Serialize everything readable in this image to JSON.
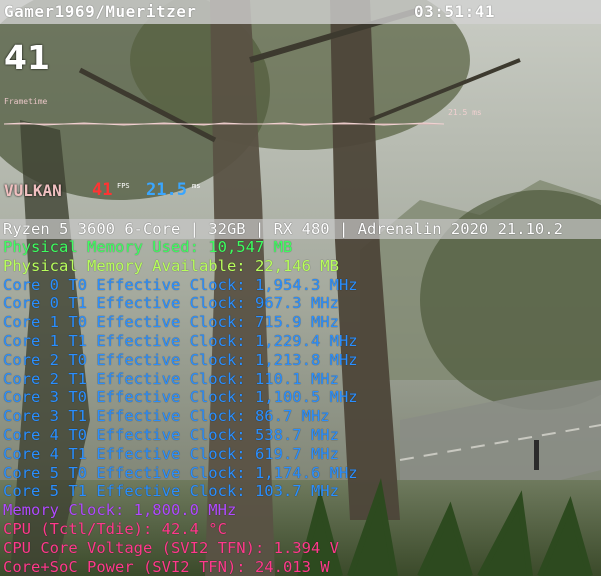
{
  "header": {
    "user": "Gamer1969/Mueritzer",
    "clock": "03:51:41"
  },
  "fps_big": "41",
  "frametime": {
    "label": "Frametime",
    "value": "21.5 ms"
  },
  "api": {
    "name": "VULKAN",
    "fps": "41",
    "fps_unit": "FPS",
    "ms": "21.5",
    "ms_unit": "ms"
  },
  "system": "Ryzen 5 3600 6-Core | 32GB | RX 480 | Adrenalin 2020 21.10.2",
  "stats": [
    {
      "text": "Physical Memory Used: 10,547 MB",
      "color": "green"
    },
    {
      "text": "Physical Memory Available: 22,146 MB",
      "color": "lime"
    },
    {
      "text": "Core 0 T0 Effective Clock: 1,954.3 MHz",
      "color": "blue"
    },
    {
      "text": "Core 0 T1 Effective Clock: 967.3 MHz",
      "color": "blue"
    },
    {
      "text": "Core 1 T0 Effective Clock: 715.9 MHz",
      "color": "blue"
    },
    {
      "text": "Core 1 T1 Effective Clock: 1,229.4 MHz",
      "color": "blue"
    },
    {
      "text": "Core 2 T0 Effective Clock: 1,213.8 MHz",
      "color": "blue"
    },
    {
      "text": "Core 2 T1 Effective Clock: 110.1 MHz",
      "color": "blue"
    },
    {
      "text": "Core 3 T0 Effective Clock: 1,100.5 MHz",
      "color": "blue"
    },
    {
      "text": "Core 3 T1 Effective Clock: 86.7 MHz",
      "color": "blue"
    },
    {
      "text": "Core 4 T0 Effective Clock: 538.7 MHz",
      "color": "blue"
    },
    {
      "text": "Core 4 T1 Effective Clock: 619.7 MHz",
      "color": "blue"
    },
    {
      "text": "Core 5 T0 Effective Clock: 1,174.6 MHz",
      "color": "blue"
    },
    {
      "text": "Core 5 T1 Effective Clock: 103.7 MHz",
      "color": "blue"
    },
    {
      "text": "Memory Clock: 1,800.0 MHz",
      "color": "purple"
    },
    {
      "text": "CPU (Tctl/Tdie): 42.4 °C",
      "color": "pink"
    },
    {
      "text": "CPU Core Voltage (SVI2 TFN): 1.394 V",
      "color": "pink"
    },
    {
      "text": "Core+SoC Power (SVI2 TFN): 24.013 W",
      "color": "pink"
    }
  ]
}
